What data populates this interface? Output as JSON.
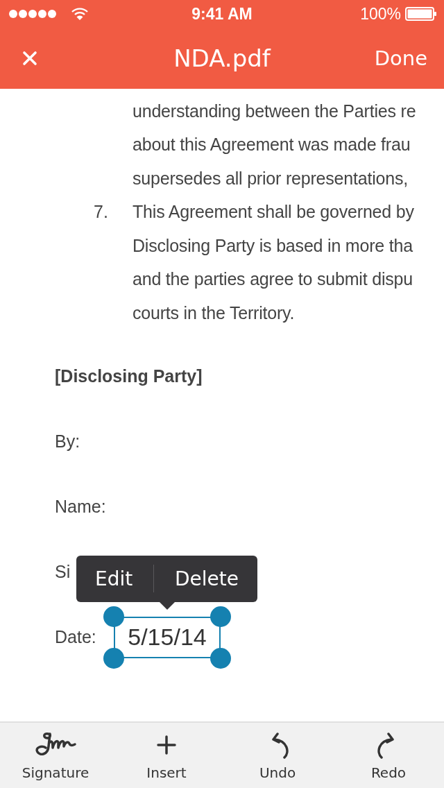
{
  "status_bar": {
    "time": "9:41 AM",
    "battery": "100%"
  },
  "nav": {
    "title": "NDA.pdf",
    "action": "Done"
  },
  "document": {
    "lines": [
      {
        "text": "understanding between the Parties re"
      },
      {
        "text": "about this Agreement was made frau"
      },
      {
        "text": "supersedes all prior representations,"
      },
      {
        "number": "7.",
        "text": "This Agreement shall be governed by"
      },
      {
        "text": "Disclosing Party is based in more tha"
      },
      {
        "text": "and the parties agree to submit dispu"
      },
      {
        "text": "courts in the Territory."
      }
    ],
    "fields": [
      {
        "kind": "heading",
        "label": "[Disclosing Party]"
      },
      {
        "kind": "line",
        "label": "By:"
      },
      {
        "kind": "line",
        "label": "Name:"
      },
      {
        "kind": "line",
        "label": "Si"
      },
      {
        "kind": "entry",
        "label": "Date:",
        "value": "5/15/14",
        "selected": true
      }
    ]
  },
  "popup": {
    "actions": [
      "Edit",
      "Delete"
    ]
  },
  "toolbar": [
    {
      "kind": "signature",
      "label": "Signature"
    },
    {
      "kind": "insert",
      "label": "Insert"
    },
    {
      "kind": "undo",
      "label": "Undo"
    },
    {
      "kind": "redo",
      "label": "Redo"
    }
  ]
}
